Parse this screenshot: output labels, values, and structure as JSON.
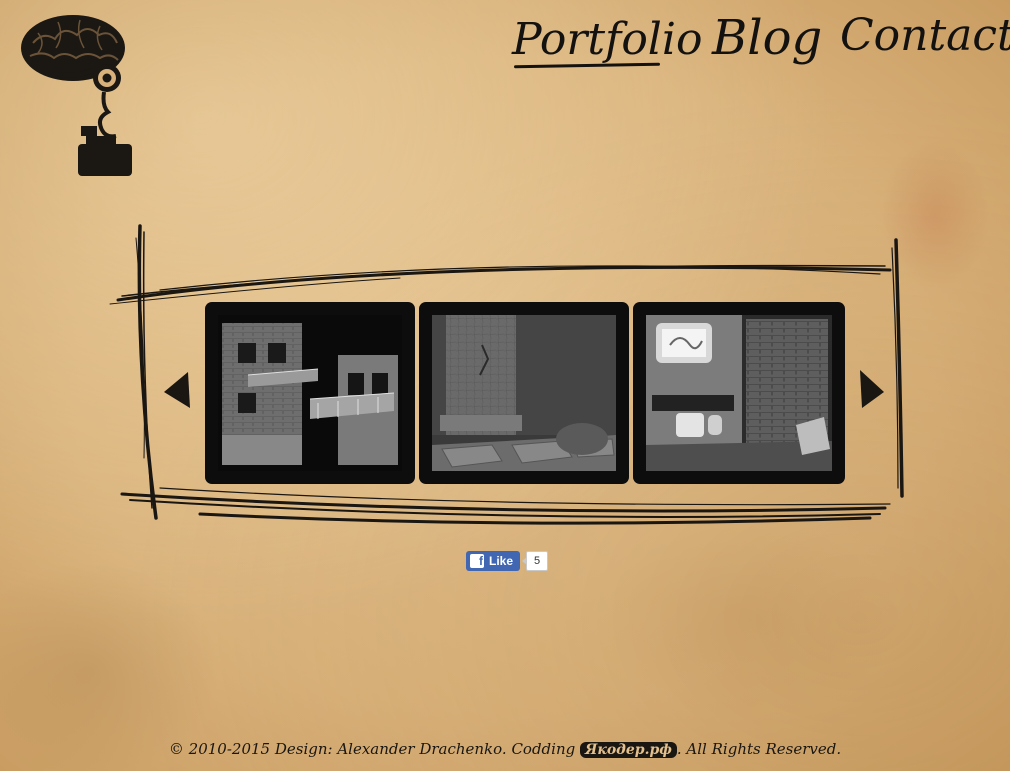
{
  "nav": {
    "portfolio": "Portfolio",
    "blog": "Blog",
    "contact": "Contact"
  },
  "logo": {
    "icon": "brain-monocle-logo"
  },
  "gallery": {
    "prev_icon": "arrow-left-icon",
    "next_icon": "arrow-right-icon",
    "items": [
      {
        "subject": "ruined-building"
      },
      {
        "subject": "stone-pillar"
      },
      {
        "subject": "bathroom-interior"
      }
    ]
  },
  "social": {
    "like_label": "Like",
    "like_count": "5"
  },
  "footer": {
    "prefix": "© 2010-2015 Design: Alexander Drachenko. Codding",
    "badge": "Якодер.рф",
    "suffix": ". All Rights Reserved."
  },
  "colors": {
    "paper": "#d9b27b",
    "ink": "#141210",
    "facebook": "#4267b2"
  }
}
